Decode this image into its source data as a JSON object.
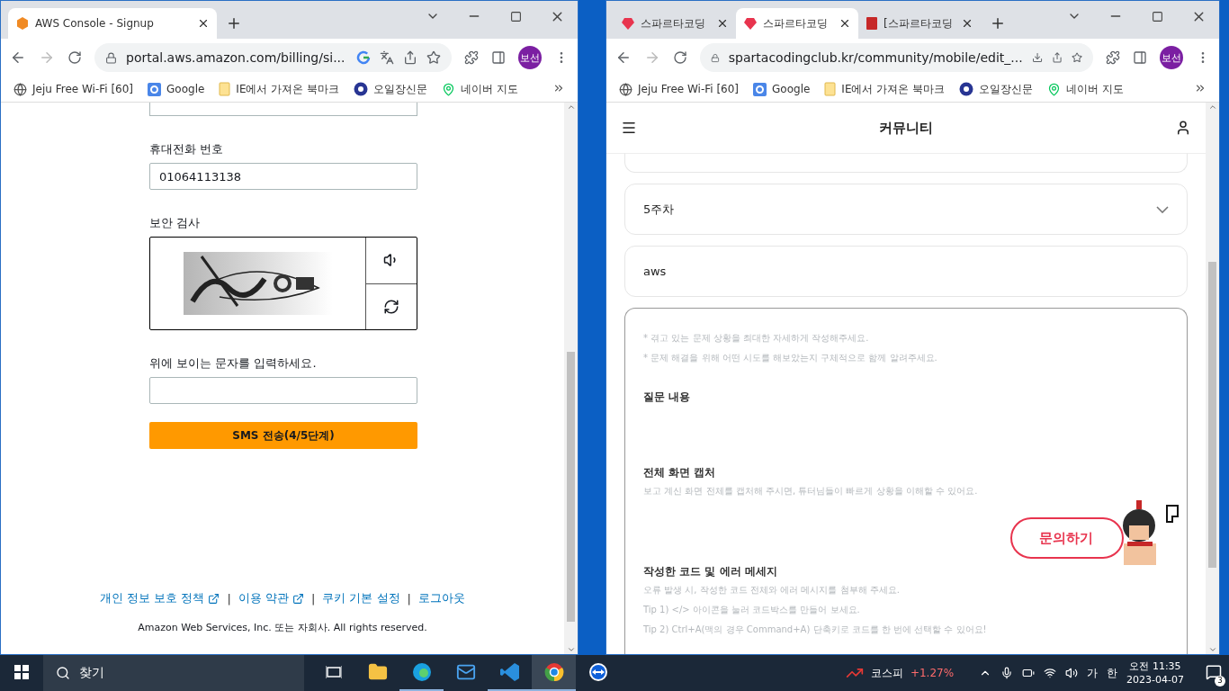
{
  "left_window": {
    "tabs": [
      {
        "title": "AWS Console - Signup",
        "kind": "cube",
        "selected": true
      }
    ],
    "address": "portal.aws.amazon.com/billing/si...",
    "address_actions": [
      {
        "kind": "google"
      },
      {
        "kind": "translate"
      },
      {
        "kind": "share"
      },
      {
        "kind": "star"
      }
    ],
    "profile": "보선",
    "bookmarks": [
      {
        "label": "Jeju Free Wi-Fi [60]",
        "kind": "globe"
      },
      {
        "label": "Google",
        "kind": "g"
      },
      {
        "label": "IE에서 가져온 북마크",
        "kind": "folder"
      },
      {
        "label": "오일장신문",
        "kind": "seal"
      },
      {
        "label": "네이버 지도",
        "kind": "pin"
      }
    ],
    "form": {
      "phone_label": "휴대전화 번호",
      "phone_value": "01064113138",
      "captcha_label": "보안 검사",
      "captcha_prompt": "위에 보이는 문자를 입력하세요.",
      "submit": "SMS 전송(4/5단계)"
    },
    "footer_links": [
      {
        "kind": "link",
        "label": "개인 정보 보호 정책",
        "external": true
      },
      {
        "kind": "separator",
        "label": "|"
      },
      {
        "kind": "link",
        "label": "이용 약관",
        "external": true
      },
      {
        "kind": "separator",
        "label": "|"
      },
      {
        "kind": "link",
        "label": "쿠키 기본 설정",
        "external": false
      },
      {
        "kind": "separator",
        "label": "|"
      },
      {
        "kind": "link",
        "label": "로그아웃",
        "external": false
      }
    ],
    "copyright": "Amazon Web Services, Inc. 또는 자회사. All rights reserved."
  },
  "right_window": {
    "tabs": [
      {
        "title": "스파르타코딩",
        "kind": "sparta",
        "selected": false
      },
      {
        "title": "스파르타코딩",
        "kind": "sparta",
        "selected": true
      },
      {
        "title": "[스파르타코딩",
        "kind": "book",
        "selected": false
      }
    ],
    "address": "spartacodingclub.kr/community/mobile/edit_...",
    "address_actions": [
      {
        "kind": "download"
      },
      {
        "kind": "share"
      },
      {
        "kind": "star"
      }
    ],
    "profile": "보선",
    "bookmarks": [
      {
        "label": "Jeju Free Wi-Fi [60]",
        "kind": "globe"
      },
      {
        "label": "Google",
        "kind": "g"
      },
      {
        "label": "IE에서 가져온 북마크",
        "kind": "folder"
      },
      {
        "label": "오일장신문",
        "kind": "seal"
      },
      {
        "label": "네이버 지도",
        "kind": "pin"
      }
    ],
    "header_title": "커뮤니티",
    "week_select": "5주차",
    "title_value": "aws",
    "editor": {
      "hints": [
        "* 겪고 있는 문제 상황을 최대한 자세하게 작성해주세요.",
        "* 문제 해결을 위해 어떤 시도를 해보았는지 구체적으로 함께 알려주세요."
      ],
      "sections": [
        {
          "heading": "질문 내용"
        },
        {
          "heading": "전체 화면 캡처",
          "lines": [
            "보고 계신 화면 전체를 캡처해 주시면, 튜터님들이 빠르게 상황을 이해할 수 있어요."
          ]
        },
        {
          "heading": "작성한 코드 및 에러 메세지",
          "lines": [
            "오류 발생 시, 작성한 코드 전체와 에러 메시지를 첨부해 주세요.",
            "Tip 1) </> 아이콘을 눌러 코드박스를 만들어 보세요.",
            "Tip 2) Ctrl+A(맥의 경우 Command+A) 단축키로 코드를 한 번에 선택할 수 있어요!"
          ]
        }
      ]
    },
    "inquiry_button": "문의하기"
  },
  "taskbar": {
    "search": "찾기",
    "apps": [
      {
        "kind": "taskview",
        "running": false,
        "selected": false
      },
      {
        "kind": "explorer",
        "running": false,
        "selected": false
      },
      {
        "kind": "edge",
        "running": true,
        "selected": false
      },
      {
        "kind": "mail",
        "running": false,
        "selected": false
      },
      {
        "kind": "vscode",
        "running": true,
        "selected": false
      },
      {
        "kind": "chrome",
        "running": true,
        "selected": true
      },
      {
        "kind": "teamviewer",
        "running": false,
        "selected": false
      }
    ],
    "stock": {
      "name": "코스피",
      "change": "+1.27%"
    },
    "ime_mode": "가",
    "ime_lang": "한",
    "time": "오전 11:35",
    "date": "2023-04-07",
    "notifications": "3"
  }
}
